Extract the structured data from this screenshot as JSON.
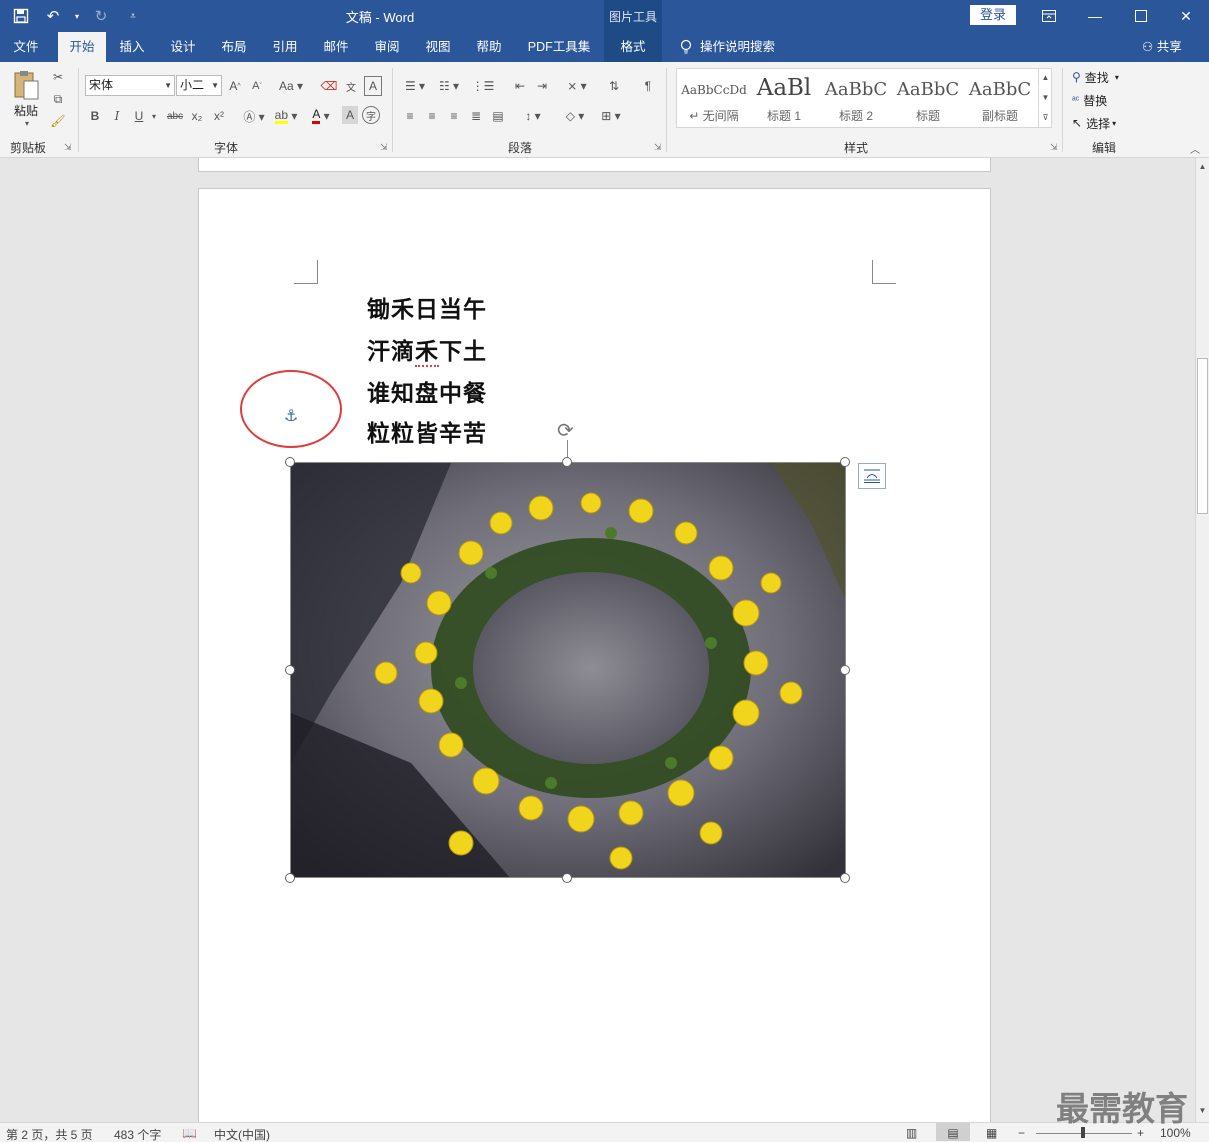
{
  "window": {
    "title": "文稿  -  Word",
    "picture_tools": "图片工具",
    "login": "登录"
  },
  "qat": {
    "save_icon": "save-icon",
    "undo_icon": "undo-icon",
    "redo_icon": "redo-icon",
    "customize_icon": "customize-icon"
  },
  "tabs": [
    "文件",
    "开始",
    "插入",
    "设计",
    "布局",
    "引用",
    "邮件",
    "审阅",
    "视图",
    "帮助",
    "PDF工具集",
    "格式"
  ],
  "active_tab": "开始",
  "tellme": "操作说明搜索",
  "share": "共享",
  "ribbon": {
    "clipboard": {
      "paste": "粘贴",
      "label": "剪贴板"
    },
    "font": {
      "name": "宋体",
      "size": "小二",
      "label": "字体",
      "bold": "B",
      "italic": "I",
      "underline": "U",
      "strike": "abc",
      "sub": "x₂",
      "sup": "x²"
    },
    "paragraph": {
      "label": "段落"
    },
    "styles": {
      "label": "样式",
      "items": [
        {
          "preview": "AaBbCcDd",
          "name": "↵ 无间隔"
        },
        {
          "preview": "AaBl",
          "name": "标题 1"
        },
        {
          "preview": "AaBbC",
          "name": "标题 2"
        },
        {
          "preview": "AaBbC",
          "name": "标题"
        },
        {
          "preview": "AaBbC",
          "name": "副标题"
        }
      ]
    },
    "editing": {
      "label": "编辑",
      "find": "查找",
      "replace": "替换",
      "select": "选择"
    }
  },
  "document": {
    "poem": [
      "锄禾日当午",
      "汗滴禾下土",
      "谁知盘中餐",
      "粒粒皆辛苦"
    ],
    "image_alt": "chrysanthemum-wreath-photo"
  },
  "status": {
    "page": "第 2 页，共 5 页",
    "words": "483 个字",
    "language": "中文(中国)",
    "zoom": "100%",
    "zoom_minus": "−",
    "zoom_plus": "+"
  },
  "watermark": "最需教育",
  "colors": {
    "accent": "#2b579a",
    "font_color_bar": "#e00000",
    "highlight_circle": "#e03c3c"
  }
}
